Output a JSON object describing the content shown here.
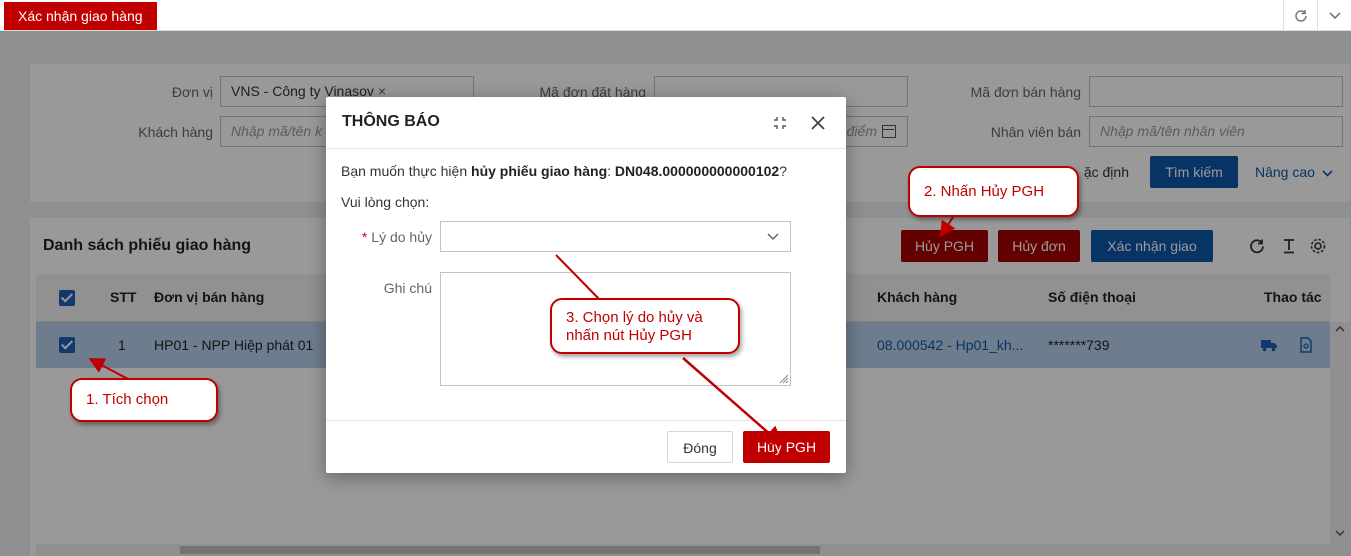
{
  "topbar": {
    "active_tab": "Xác nhận giao hàng",
    "icons": [
      "refresh-icon",
      "chevron-down-icon"
    ]
  },
  "filter": {
    "don_vi_label": "Đơn vị",
    "don_vi_value": "VNS - Công ty Vinasov",
    "khach_hang_label": "Khách hàng",
    "khach_hang_placeholder": "Nhập mã/tên k",
    "ma_don_dat_hang_label": "Mã đơn đặt hàng",
    "date_partial": "ời điểm",
    "ma_don_ban_hang_label": "Mã đơn bán hàng",
    "nhan_vien_ban_label": "Nhân viên bán",
    "nhan_vien_ban_placeholder": "Nhập mã/tên nhân viên",
    "default_button_partial": "ặc định",
    "search_button": "Tìm kiếm",
    "advanced_link": "Nâng cao"
  },
  "list": {
    "title": "Danh sách phiếu giao hàng",
    "huy_pgh_button": "Hủy PGH",
    "huy_don_button": "Hủy đơn",
    "xac_nhan_giao_button": "Xác nhận giao",
    "columns": {
      "stt": "STT",
      "don_vi_ban_hang": "Đơn vị bán hàng",
      "khach_hang": "Khách hàng",
      "so_dien_thoai": "Số điện thoại",
      "thao_tac": "Thao tác"
    },
    "rows": [
      {
        "stt": "1",
        "don_vi_ban_hang": "HP01 - NPP Hiệp phát 01",
        "khach_hang": "08.000542 - Hp01_kh...",
        "so_dien_thoai": "*******739"
      }
    ]
  },
  "dialog": {
    "title": "THÔNG BÁO",
    "message_prefix": "Bạn muốn thực hiện ",
    "message_action": "hủy phiếu giao hàng",
    "message_colon": ": ",
    "message_code": "DN048.000000000000102",
    "message_suffix": "?",
    "prompt": "Vui lòng chọn:",
    "reason_label": "Lý do hủy",
    "reason_required_mark": "*",
    "note_label": "Ghi chú",
    "close_button": "Đóng",
    "confirm_button": "Hủy PGH"
  },
  "callouts": {
    "step1": "1. Tích chọn",
    "step2": "2. Nhấn Hủy PGH",
    "step3_line1": "3. Chọn lý do hủy và",
    "step3_line2": "nhấn nút Hủy PGH"
  },
  "colors": {
    "brand_red": "#c00000",
    "button_red": "#a50000",
    "primary_blue": "#0e58a8",
    "selected_row": "#b8d0ec"
  }
}
